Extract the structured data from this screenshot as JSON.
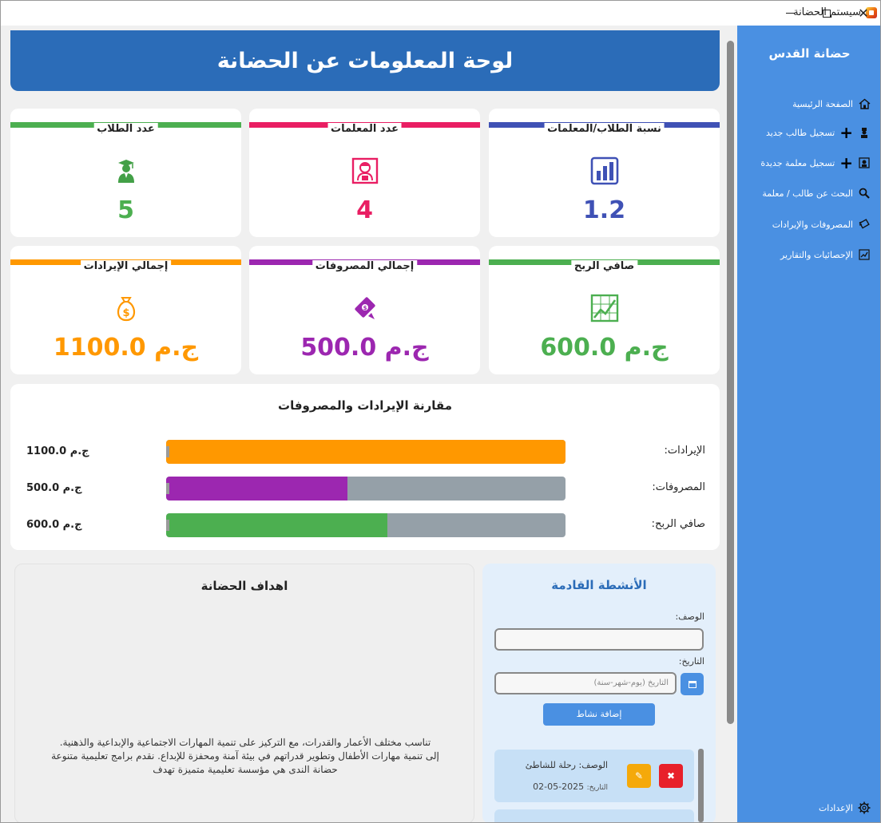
{
  "window": {
    "title": "سيستم الحضانة",
    "minimize": "—",
    "maximize": "☐",
    "close": "✕"
  },
  "sidebar": {
    "brand": "حضانة القدس",
    "items": [
      {
        "label": "الصفحة الرئيسية",
        "icon": "home-icon"
      },
      {
        "label": "تسجيل طالب جديد",
        "icon": "add-student-icon"
      },
      {
        "label": "تسجيل معلمة جديدة",
        "icon": "add-teacher-icon"
      },
      {
        "label": "البحث عن طالب / معلمة",
        "icon": "search-icon"
      },
      {
        "label": "المصروفات والإيرادات",
        "icon": "money-icon"
      },
      {
        "label": "الإحصائيات والتقارير",
        "icon": "chart-icon"
      }
    ],
    "settings_label": "الإعدادات"
  },
  "header": {
    "title": "لوحة المعلومات عن الحضانة"
  },
  "stats": [
    {
      "title": "عدد الطلاب",
      "value": "5",
      "color": "#4caf50",
      "icon": "student-icon"
    },
    {
      "title": "عدد المعلمات",
      "value": "4",
      "color": "#e91e63",
      "icon": "teacher-icon"
    },
    {
      "title": "نسبة الطلاب/المعلمات",
      "value": "1.2",
      "color": "#3f51b5",
      "icon": "bar-chart-icon"
    },
    {
      "title": "إجمالي الإيرادات",
      "value": "ج.م 1100.0",
      "color": "#ff9800",
      "icon": "money-bag-icon"
    },
    {
      "title": "إجمالي المصروفات",
      "value": "ج.م 500.0",
      "color": "#9c27b0",
      "icon": "money-wings-icon"
    },
    {
      "title": "صافي الربح",
      "value": "ج.م 600.0",
      "color": "#4caf50",
      "icon": "trend-up-icon"
    }
  ],
  "comparison": {
    "title": "مقارنة الإيرادات والمصروفات",
    "rows": [
      {
        "label": "الإيرادات:",
        "amount": "ج.م 1100.0",
        "fraction": 1.0,
        "color": "#ff9800"
      },
      {
        "label": "المصروفات:",
        "amount": "ج.م 500.0",
        "fraction": 0.4545,
        "color": "#9c27b0"
      },
      {
        "label": "صافي الربح:",
        "amount": "ج.م 600.0",
        "fraction": 0.5545,
        "color": "#4caf50"
      }
    ]
  },
  "goals": {
    "title": "اهداف الحضانة",
    "lines": [
      "تناسب مختلف الأعمار والقدرات، مع التركيز على تنمية المهارات الاجتماعية والإبداعية والذهنية.",
      "إلى تنمية مهارات الأطفال وتطوير قدراتهم في بيئة آمنة ومحفزة للإبداع. نقدم برامج تعليمية متنوعة",
      "حضانة الندى هي مؤسسة تعليمية متميزة تهدف"
    ]
  },
  "activities": {
    "title": "الأنشطة القادمة",
    "desc_label": "الوصف:",
    "date_label": "التاريخ:",
    "date_placeholder": "التاريخ (يوم-شهر-سنة)",
    "add_label": "إضافة نشاط",
    "items": [
      {
        "desc_key": "الوصف:",
        "desc": "رحلة للشاطئ",
        "date_key": "التاريخ:",
        "date": "2025-05-02",
        "edit": "✎",
        "delete": "✖"
      }
    ]
  },
  "colors": {
    "sidebar": "#4a90e2",
    "header": "#2b6cb8",
    "track": "#95a0a8"
  }
}
